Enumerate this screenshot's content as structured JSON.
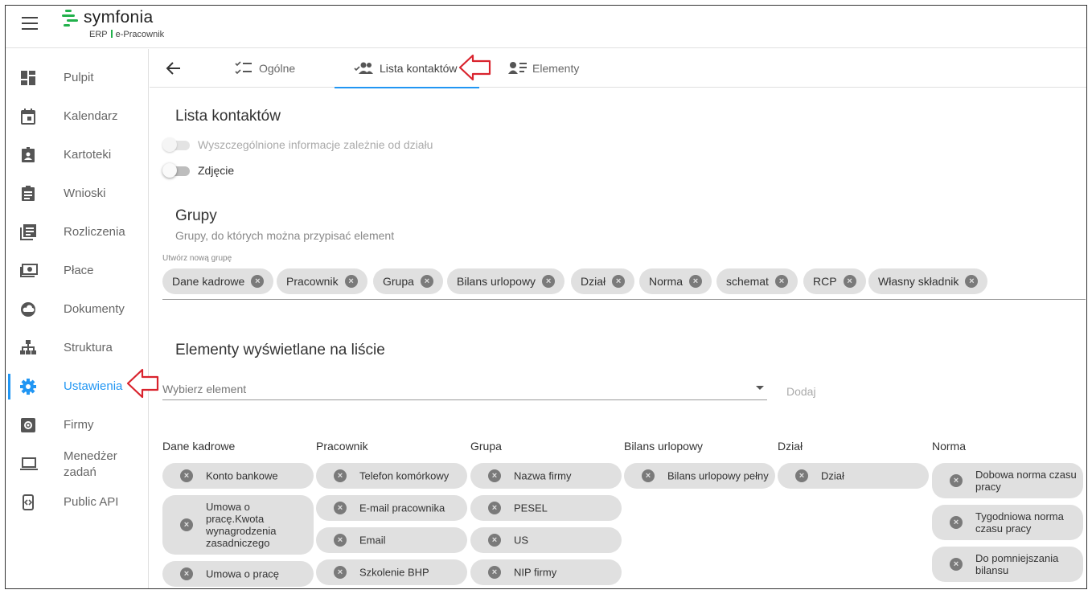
{
  "header": {
    "brand": "symfonia",
    "sub_left": "ERP",
    "sub_right": "e-Pracownik",
    "brand_color": "#22b14c"
  },
  "sidebar": {
    "items": [
      {
        "label": "Pulpit",
        "icon": "dashboard-icon"
      },
      {
        "label": "Kalendarz",
        "icon": "calendar-icon"
      },
      {
        "label": "Kartoteki",
        "icon": "badge-icon"
      },
      {
        "label": "Wnioski",
        "icon": "clipboard-icon"
      },
      {
        "label": "Rozliczenia",
        "icon": "list-icon"
      },
      {
        "label": "Płace",
        "icon": "money-icon"
      },
      {
        "label": "Dokumenty",
        "icon": "cloud-icon"
      },
      {
        "label": "Struktura",
        "icon": "sitemap-icon"
      },
      {
        "label": "Ustawienia",
        "icon": "gear-icon",
        "active": true
      },
      {
        "label": "Firmy",
        "icon": "settings-box-icon"
      },
      {
        "label": "Menedżer zadań",
        "icon": "laptop-icon"
      },
      {
        "label": "Public API",
        "icon": "api-icon"
      }
    ],
    "active_color": "#2196f3"
  },
  "tabs": [
    {
      "label": "Ogólne",
      "icon": "checklist-icon"
    },
    {
      "label": "Lista kontaktów",
      "icon": "contacts-icon",
      "active": true
    },
    {
      "label": "Elementy",
      "icon": "person-list-icon"
    }
  ],
  "contacts": {
    "title": "Lista kontaktów",
    "toggle_dept": "Wyszczególnione informacje zależnie od działu",
    "toggle_photo": "Zdjęcie"
  },
  "groups": {
    "title": "Grupy",
    "subtitle": "Grupy, do których można przypisać element",
    "field_label": "Utwórz nową grupę",
    "chips": [
      "Dane kadrowe",
      "Pracownik",
      "Grupa",
      "Bilans urlopowy",
      "Dział",
      "Norma",
      "schemat",
      "RCP",
      "Własny składnik"
    ]
  },
  "elements": {
    "title": "Elementy wyświetlane na liście",
    "select_placeholder": "Wybierz element",
    "add_label": "Dodaj",
    "columns": [
      {
        "name": "Dane kadrowe",
        "items": [
          "Konto bankowe",
          "Umowa o pracę.Kwota wynagrodzenia zasadniczego",
          "Umowa o pracę"
        ]
      },
      {
        "name": "Pracownik",
        "items": [
          "Telefon komórkowy",
          "E-mail pracownika",
          "Email",
          "Szkolenie BHP"
        ]
      },
      {
        "name": "Grupa",
        "items": [
          "Nazwa firmy",
          "PESEL",
          "US",
          "NIP firmy"
        ]
      },
      {
        "name": "Bilans urlopowy",
        "items": [
          "Bilans urlopowy pełny"
        ]
      },
      {
        "name": "Dział",
        "items": [
          "Dział"
        ]
      },
      {
        "name": "Norma",
        "items": [
          "Dobowa norma czasu pracy",
          "Tygodniowa norma czasu pracy",
          "Do pomniejszania bilansu"
        ]
      }
    ]
  }
}
